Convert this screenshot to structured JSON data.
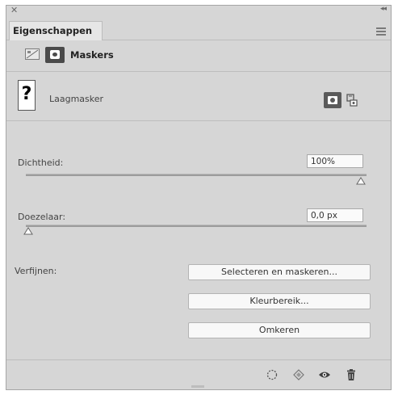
{
  "panel": {
    "tab_label": "Eigenschappen",
    "properties_type": "Maskers"
  },
  "mask": {
    "thumbnail_glyph": "?",
    "label": "Laagmasker"
  },
  "density": {
    "label": "Dichtheid:",
    "value": "100%",
    "slider_fraction": 1.0
  },
  "feather": {
    "label": "Doezelaar:",
    "value": "0,0 px",
    "slider_fraction": 0.0
  },
  "refine": {
    "label": "Verfijnen:",
    "select_and_mask_label": "Selecteren en maskeren...",
    "color_range_label": "Kleurbereik...",
    "invert_label": "Omkeren"
  },
  "bottom_icons": [
    "load-selection-icon",
    "apply-mask-icon",
    "visibility-eye-icon",
    "trash-icon"
  ],
  "colors": {
    "panel_bg": "#d6d6d6",
    "button_bg": "#f8f8f8",
    "active_icon_bg": "#4a4a4a"
  }
}
